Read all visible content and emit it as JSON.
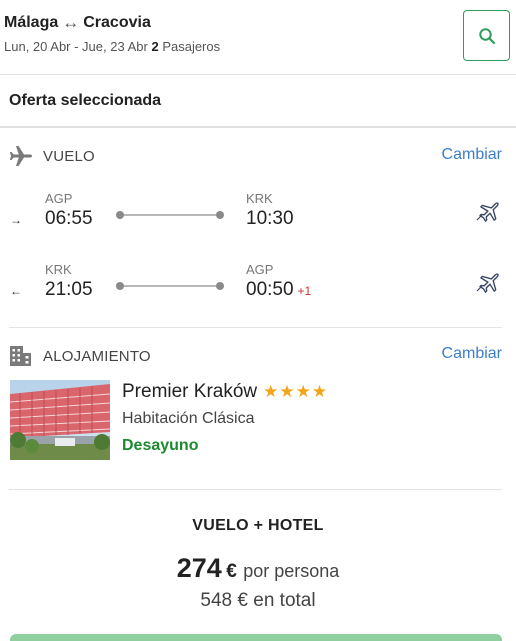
{
  "header": {
    "origin": "Málaga",
    "swap_symbol": "↔",
    "destination": "Cracovia",
    "dates": "Lun, 20 Abr - Jue, 23 Abr",
    "passengers_count": "2",
    "passengers_label": "Pasajeros"
  },
  "section_title": "Oferta seleccionada",
  "flight_section": {
    "label": "VUELO",
    "change_label": "Cambiar",
    "outbound": {
      "direction_symbol": "→",
      "from_code": "AGP",
      "from_time": "06:55",
      "to_code": "KRK",
      "to_time": "10:30",
      "day_offset": ""
    },
    "inbound": {
      "direction_symbol": "←",
      "from_code": "KRK",
      "from_time": "21:05",
      "to_code": "AGP",
      "to_time": "00:50",
      "day_offset": "+1"
    }
  },
  "hotel_section": {
    "label": "ALOJAMIENTO",
    "change_label": "Cambiar",
    "name": "Premier Kraków",
    "stars": "★★★★",
    "star_count": 4,
    "room": "Habitación Clásica",
    "board": "Desayuno"
  },
  "summary": {
    "package_title": "VUELO + HOTEL",
    "price_per_person": "274",
    "currency": "€",
    "per_person_label": "por persona",
    "total_price": "548 € en total"
  },
  "colors": {
    "accent_green": "#2e9d5a",
    "link_blue": "#3d7ec9",
    "star_gold": "#f2a51a",
    "board_green": "#1d8a2f",
    "day_offset_red": "#d0322f"
  }
}
